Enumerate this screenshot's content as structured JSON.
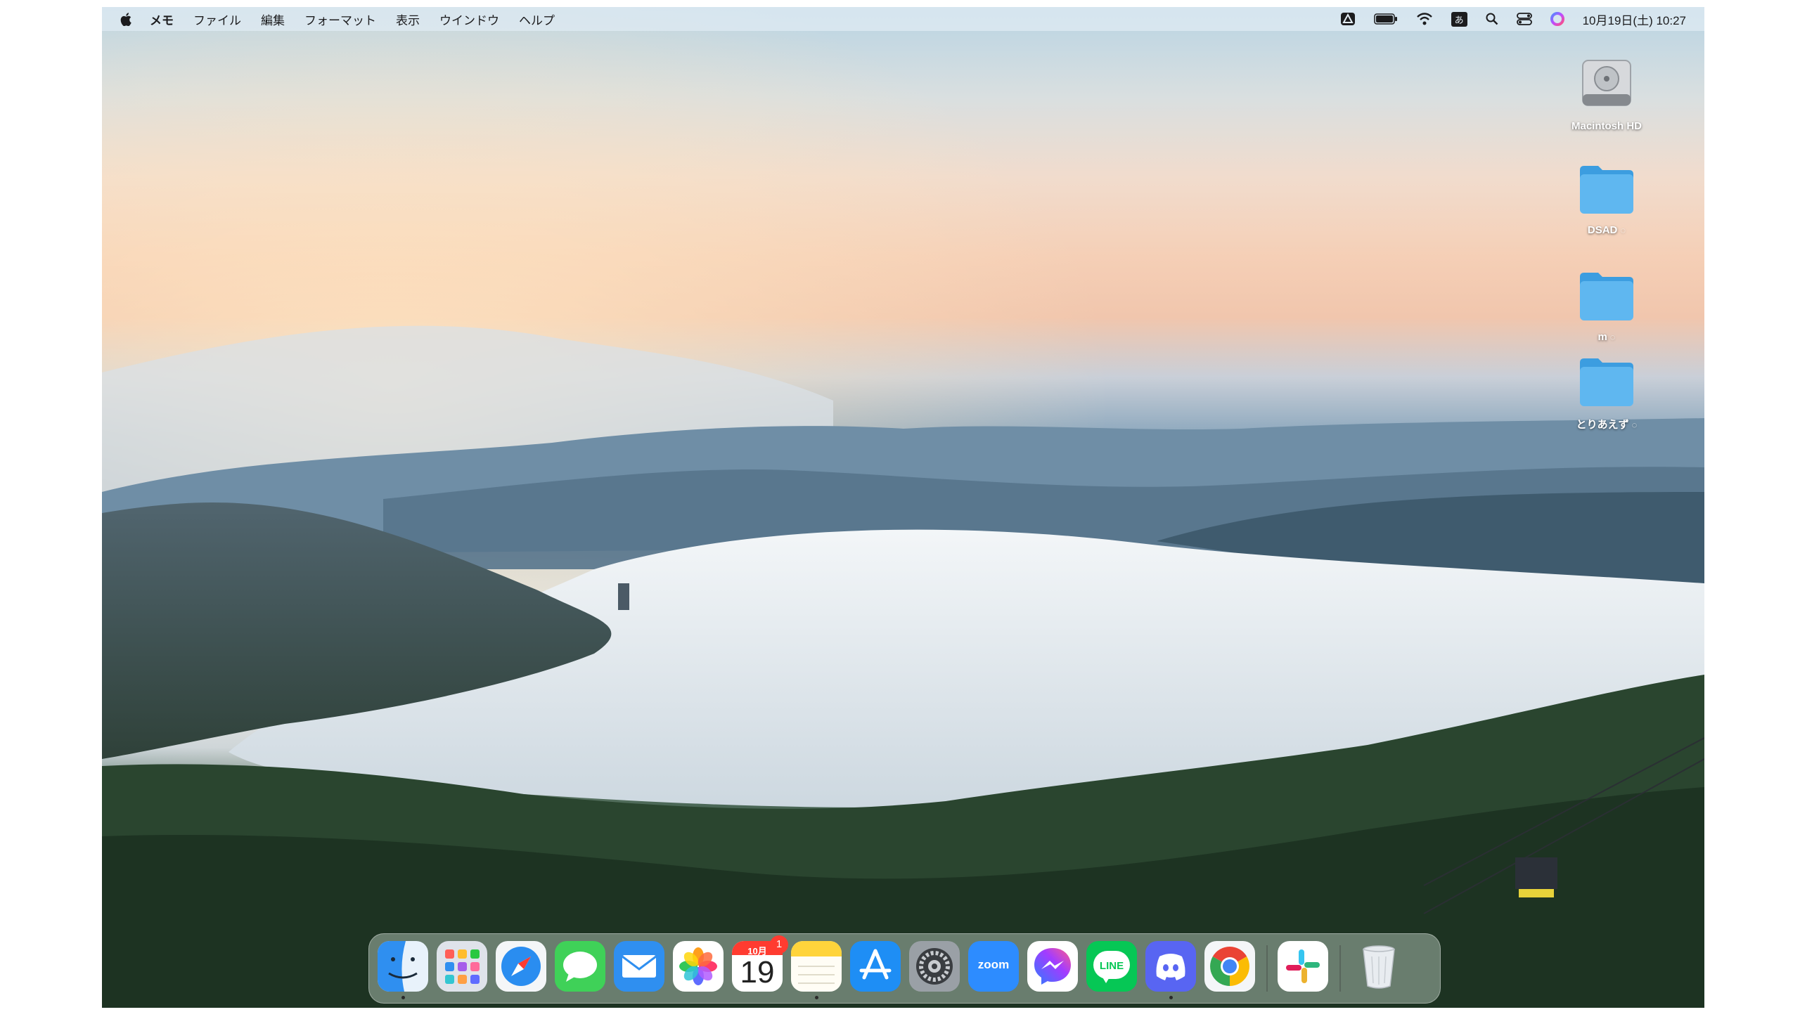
{
  "menubar": {
    "app_name": "メモ",
    "menus": [
      "ファイル",
      "編集",
      "フォーマット",
      "表示",
      "ウインドウ",
      "ヘルプ"
    ],
    "ime_label": "あ",
    "clock": "10月19日(土) 10:27"
  },
  "desktop": {
    "icons": [
      {
        "label": "Macintosh HD",
        "icon": "hard-drive-icon"
      },
      {
        "label": "DSAD",
        "icon": "folder-icon",
        "icloud": "◌"
      },
      {
        "label": "m",
        "icon": "folder-icon",
        "icloud": "◌"
      },
      {
        "label": "とりあえず",
        "icon": "folder-icon",
        "icloud": "◌"
      }
    ]
  },
  "dock": {
    "apps": [
      {
        "icon": "finder-icon",
        "running": true
      },
      {
        "icon": "launchpad-icon",
        "running": false
      },
      {
        "icon": "safari-icon",
        "running": false
      },
      {
        "icon": "messages-icon",
        "running": false
      },
      {
        "icon": "mail-icon",
        "running": false
      },
      {
        "icon": "photos-icon",
        "running": false
      },
      {
        "icon": "calendar-icon",
        "running": false,
        "month": "10月",
        "day": "19",
        "badge": "1"
      },
      {
        "icon": "notes-icon",
        "running": true
      },
      {
        "icon": "app-store-icon",
        "running": false
      },
      {
        "icon": "system-settings-icon",
        "running": false
      },
      {
        "icon": "zoom-icon",
        "running": false,
        "label": "zoom"
      },
      {
        "icon": "messenger-icon",
        "running": false
      },
      {
        "icon": "line-icon",
        "running": false,
        "label": "LINE"
      },
      {
        "icon": "discord-icon",
        "running": true
      },
      {
        "icon": "chrome-icon",
        "running": false
      },
      {
        "icon": "slack-icon",
        "running": false
      },
      {
        "icon": "trash-icon",
        "running": false
      }
    ]
  }
}
